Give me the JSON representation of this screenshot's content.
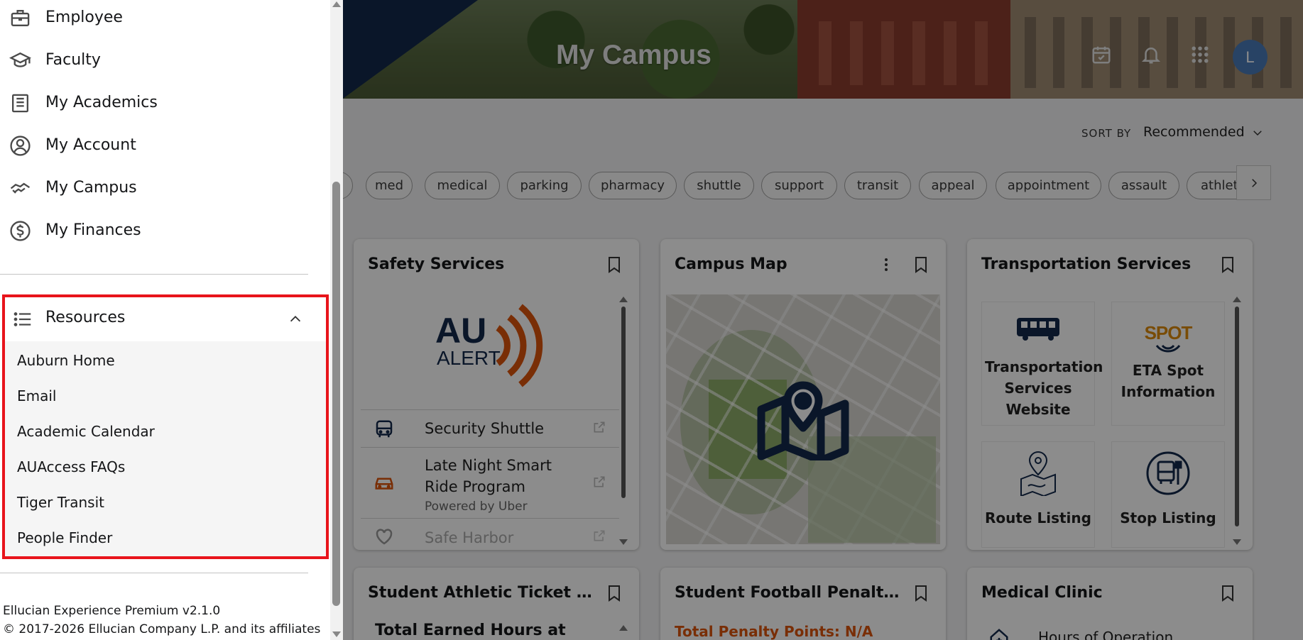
{
  "header": {
    "title": "My Campus",
    "avatar_initial": "L"
  },
  "sort": {
    "label": "SORT BY",
    "value": "Recommended"
  },
  "chips": [
    "med",
    "medical",
    "parking",
    "pharmacy",
    "shuttle",
    "support",
    "transit",
    "appeal",
    "appointment",
    "assault",
    "athlet"
  ],
  "cards": {
    "safety": {
      "title": "Safety Services",
      "logo_text": "AU",
      "logo_sub": "ALERT",
      "items": [
        {
          "label": "Security Shuttle",
          "icon": "bus-icon"
        },
        {
          "label": "Late Night Smart Ride Program",
          "sub": "Powered by Uber",
          "icon": "car-icon"
        },
        {
          "label": "Safe Harbor",
          "icon": "heart-hands-icon"
        }
      ]
    },
    "map": {
      "title": "Campus Map"
    },
    "transport": {
      "title": "Transportation Services",
      "tiles": [
        "Transportation Services Website",
        "ETA Spot Information",
        "Route Listing",
        "Stop Listing"
      ],
      "spot_logo": "SPOT"
    },
    "athletic": {
      "title": "Student Athletic Ticket Ord...",
      "content": "Total Earned Hours at"
    },
    "penalty": {
      "title": "Student Football Penalty P...",
      "content": "Total Penalty Points: N/A"
    },
    "clinic": {
      "title": "Medical Clinic",
      "content": "Hours of Operation"
    }
  },
  "drawer": {
    "nav": [
      "Employee",
      "Faculty",
      "My Academics",
      "My Account",
      "My Campus",
      "My Finances"
    ],
    "resources": {
      "title": "Resources",
      "items": [
        "Auburn Home",
        "Email",
        "Academic Calendar",
        "AUAccess FAQs",
        "Tiger Transit",
        "People Finder"
      ]
    },
    "footer": {
      "version": "Ellucian Experience Premium v2.1.0",
      "copyright": "© 2017-2026 Ellucian Company L.P. and its affiliates"
    }
  },
  "colors": {
    "highlight": "#e8141b",
    "brand_navy": "#13294b",
    "brand_orange": "#dd550c",
    "avatar": "#4a7ab8"
  }
}
